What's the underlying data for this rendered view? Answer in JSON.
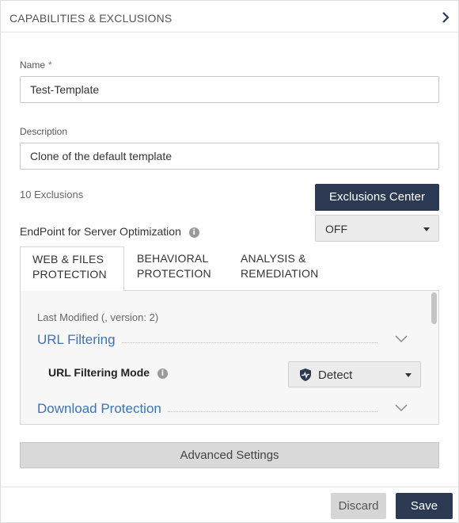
{
  "header": {
    "title": "CAPABILITIES & EXCLUSIONS"
  },
  "form": {
    "name_label": "Name",
    "name_required_mark": "*",
    "name_value": "Test-Template",
    "description_label": "Description",
    "description_value": "Clone of the default template"
  },
  "exclusions": {
    "count_text": "10 Exclusions",
    "center_button": "Exclusions Center"
  },
  "server_optimization": {
    "label": "EndPoint for Server Optimization",
    "selected": "OFF"
  },
  "tabs": [
    {
      "line1": "WEB & FILES",
      "line2": "PROTECTION",
      "active": true
    },
    {
      "line1": "BEHAVIORAL",
      "line2": "PROTECTION",
      "active": false
    },
    {
      "line1": "ANALYSIS &",
      "line2": "REMEDIATION",
      "active": false
    }
  ],
  "content": {
    "last_modified": "Last Modified (, version: 2)",
    "url_filtering": {
      "title": "URL Filtering",
      "mode_label": "URL Filtering Mode",
      "mode_value": "Detect"
    },
    "download_protection": {
      "title": "Download Protection"
    }
  },
  "advanced_settings": "Advanced Settings",
  "footer": {
    "discard": "Discard",
    "save": "Save"
  },
  "colors": {
    "primary_button": "#2b3a52",
    "link_blue": "#3d74b3",
    "required_red": "#d9534f"
  }
}
